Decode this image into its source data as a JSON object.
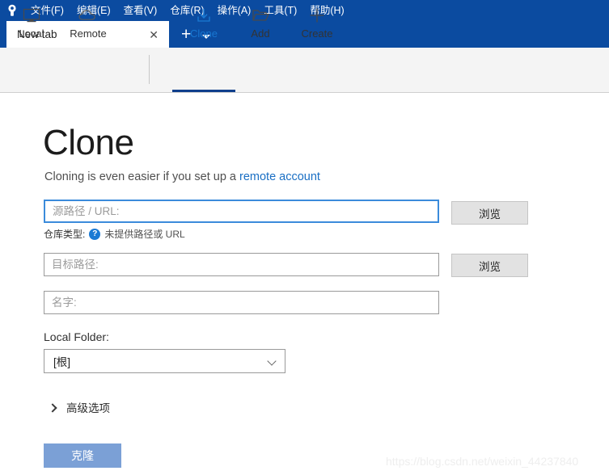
{
  "menubar": {
    "logo_icon": "sourcetree-keyhole-icon",
    "items": [
      {
        "label": "文件(F)",
        "accel": "F"
      },
      {
        "label": "编辑(E)",
        "accel": "E"
      },
      {
        "label": "查看(V)",
        "accel": "V"
      },
      {
        "label": "仓库(R)",
        "accel": "R"
      },
      {
        "label": "操作(A)",
        "accel": "A"
      },
      {
        "label": "工具(T)",
        "accel": "T"
      },
      {
        "label": "帮助(H)",
        "accel": "H"
      }
    ]
  },
  "tabstrip": {
    "tab_label": "New tab",
    "close_icon": "close-icon",
    "new_tab_icon": "plus-icon",
    "menu_arrow_icon": "chevron-down-icon"
  },
  "toolbar": {
    "buttons": [
      {
        "label": "Local",
        "icon": "monitor-icon",
        "active": false
      },
      {
        "label": "Remote",
        "icon": "cloud-icon",
        "active": false
      },
      {
        "label": "Clone",
        "icon": "download-icon",
        "active": true
      },
      {
        "label": "Add",
        "icon": "folder-open-icon",
        "active": false
      },
      {
        "label": "Create",
        "icon": "plus-icon",
        "active": false
      }
    ]
  },
  "main": {
    "title": "Clone",
    "subtitle_prefix": "Cloning is even easier if you set up a ",
    "subtitle_link": "remote account",
    "source_path": {
      "value": "",
      "placeholder": "源路径 / URL:",
      "browse_label": "浏览"
    },
    "repo_type": {
      "label": "仓库类型:",
      "help_icon": "question-mark-icon",
      "message": "未提供路径或 URL"
    },
    "dest_path": {
      "value": "",
      "placeholder": "目标路径:",
      "browse_label": "浏览"
    },
    "name": {
      "value": "",
      "placeholder": "名字:"
    },
    "local_folder": {
      "label": "Local Folder:",
      "selected": "[根]",
      "chevron_icon": "chevron-down-icon"
    },
    "advanced": {
      "label": "高级选项",
      "chevron_icon": "chevron-right-icon",
      "expanded": false
    },
    "clone_button": {
      "label": "克隆",
      "color": "#7ba0d6",
      "enabled": false
    }
  },
  "watermark": {
    "text": "https://blog.csdn.net/weixin_44237840"
  },
  "colors": {
    "titlebar_blue": "#0b4ba0",
    "accent_blue": "#1777d2",
    "active_underline": "#103f8c",
    "toolbar_bg": "#f4f4f4"
  }
}
